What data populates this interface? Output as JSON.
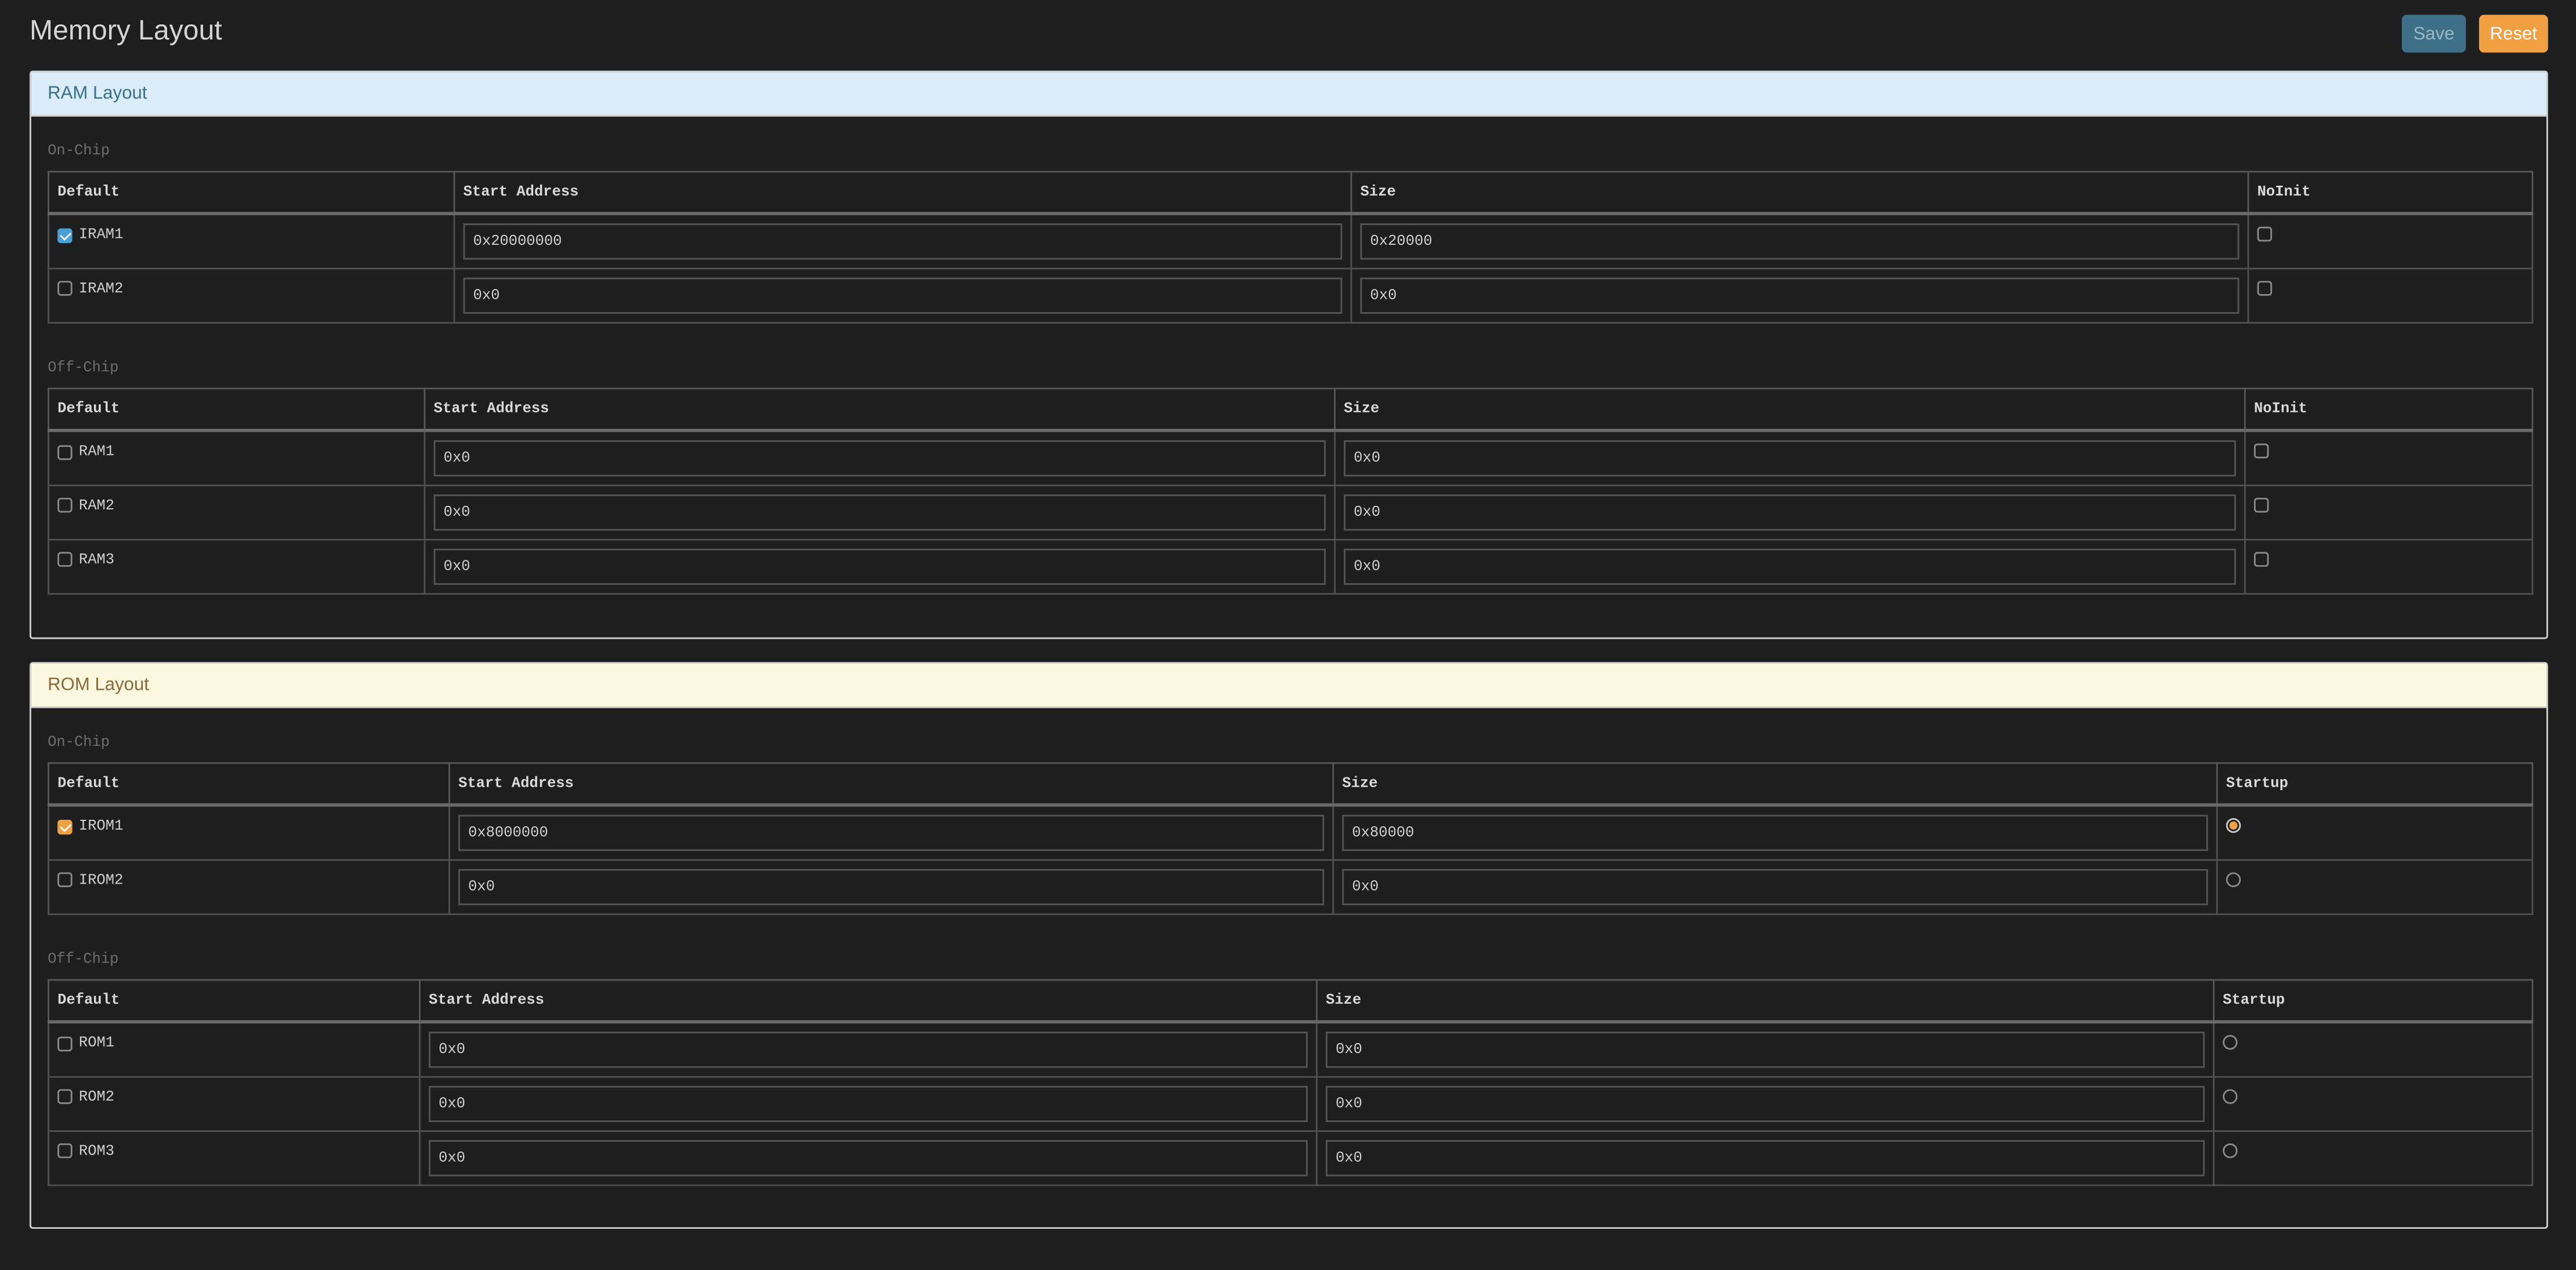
{
  "page": {
    "title": "Memory Layout",
    "save_label": "Save",
    "reset_label": "Reset"
  },
  "ram": {
    "title": "RAM Layout",
    "on_chip_label": "On-Chip",
    "off_chip_label": "Off-Chip",
    "columns": {
      "default": "Default",
      "start": "Start Address",
      "size": "Size",
      "flag": "NoInit"
    },
    "on_chip": [
      {
        "name": "IRAM1",
        "default": true,
        "start": "0x20000000",
        "size": "0x20000",
        "noinit": false
      },
      {
        "name": "IRAM2",
        "default": false,
        "start": "0x0",
        "size": "0x0",
        "noinit": false
      }
    ],
    "off_chip": [
      {
        "name": "RAM1",
        "default": false,
        "start": "0x0",
        "size": "0x0",
        "noinit": false
      },
      {
        "name": "RAM2",
        "default": false,
        "start": "0x0",
        "size": "0x0",
        "noinit": false
      },
      {
        "name": "RAM3",
        "default": false,
        "start": "0x0",
        "size": "0x0",
        "noinit": false
      }
    ]
  },
  "rom": {
    "title": "ROM Layout",
    "on_chip_label": "On-Chip",
    "off_chip_label": "Off-Chip",
    "columns": {
      "default": "Default",
      "start": "Start Address",
      "size": "Size",
      "flag": "Startup"
    },
    "on_chip": [
      {
        "name": "IROM1",
        "default": true,
        "start": "0x8000000",
        "size": "0x80000",
        "startup": true
      },
      {
        "name": "IROM2",
        "default": false,
        "start": "0x0",
        "size": "0x0",
        "startup": false
      }
    ],
    "off_chip": [
      {
        "name": "ROM1",
        "default": false,
        "start": "0x0",
        "size": "0x0",
        "startup": false
      },
      {
        "name": "ROM2",
        "default": false,
        "start": "0x0",
        "size": "0x0",
        "startup": false
      },
      {
        "name": "ROM3",
        "default": false,
        "start": "0x0",
        "size": "0x0",
        "startup": false
      }
    ]
  },
  "colors": {
    "background": "#1e1e1e",
    "ram_header_bg": "#d9ecf7",
    "rom_header_bg": "#fcf7df",
    "save_button": "#3d6f86",
    "reset_button": "#f0a040",
    "ram_check": "#4aa0d4",
    "rom_check": "#f0a040"
  }
}
